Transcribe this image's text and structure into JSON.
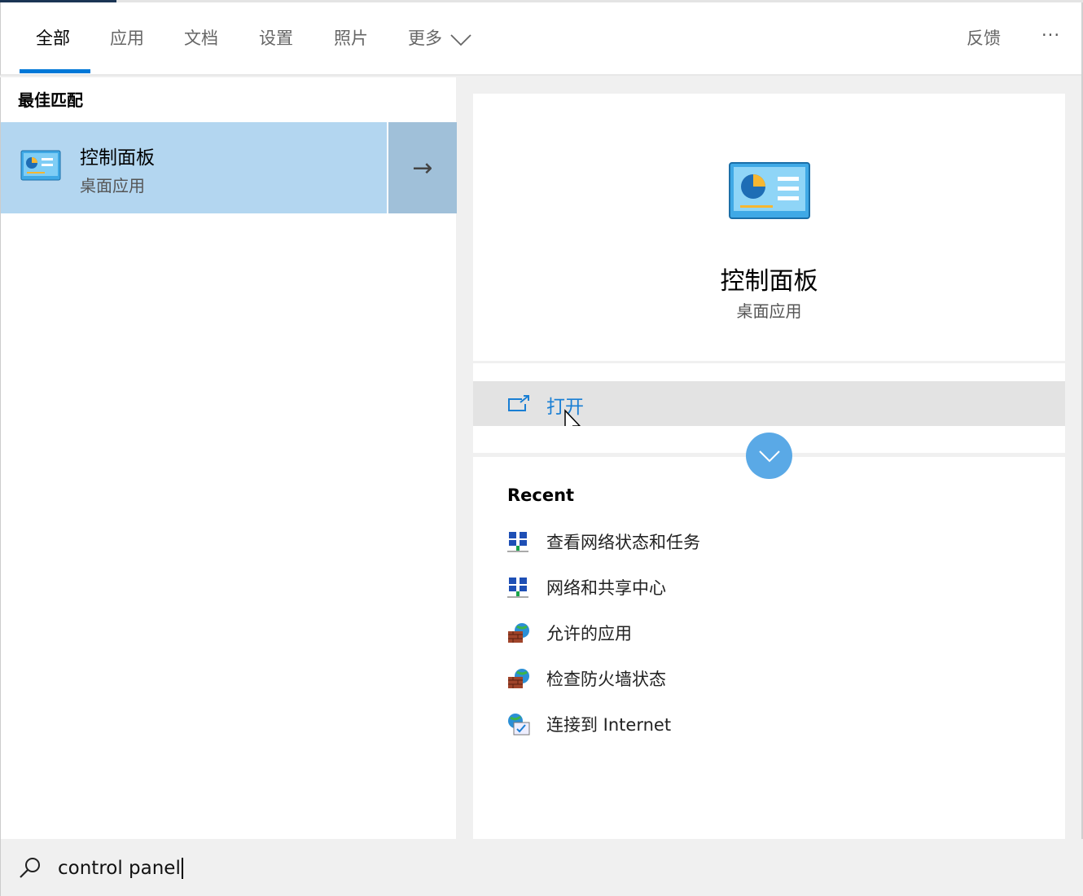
{
  "tabs": [
    {
      "label": "全部",
      "active": true
    },
    {
      "label": "应用"
    },
    {
      "label": "文档"
    },
    {
      "label": "设置"
    },
    {
      "label": "照片"
    },
    {
      "label": "更多"
    }
  ],
  "header": {
    "feedback": "反馈",
    "more_options": "···"
  },
  "best_match": {
    "heading": "最佳匹配",
    "title": "控制面板",
    "subtitle": "桌面应用"
  },
  "detail": {
    "title": "控制面板",
    "subtitle": "桌面应用",
    "open_label": "打开",
    "recent_heading": "Recent",
    "recent": [
      {
        "label": "查看网络状态和任务",
        "icon": "network-icon"
      },
      {
        "label": "网络和共享中心",
        "icon": "network-icon"
      },
      {
        "label": "允许的应用",
        "icon": "firewall-icon"
      },
      {
        "label": "检查防火墙状态",
        "icon": "firewall-icon"
      },
      {
        "label": "连接到 Internet",
        "icon": "internet-icon"
      }
    ]
  },
  "search": {
    "value": "control panel"
  },
  "colors": {
    "accent": "#0078d7",
    "selected": "#b3d6f0"
  }
}
